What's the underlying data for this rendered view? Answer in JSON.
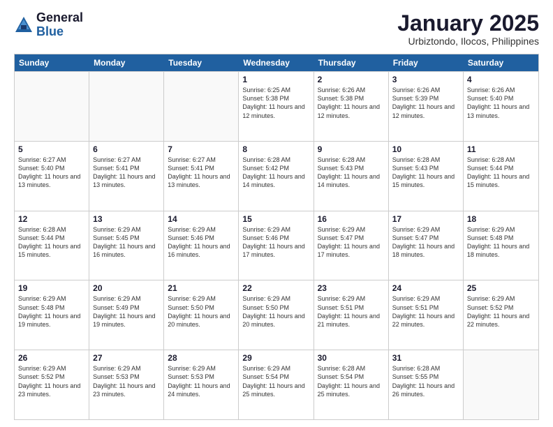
{
  "logo": {
    "general": "General",
    "blue": "Blue"
  },
  "header": {
    "month": "January 2025",
    "location": "Urbiztondo, Ilocos, Philippines"
  },
  "weekdays": [
    "Sunday",
    "Monday",
    "Tuesday",
    "Wednesday",
    "Thursday",
    "Friday",
    "Saturday"
  ],
  "weeks": [
    [
      {
        "day": "",
        "sunrise": "",
        "sunset": "",
        "daylight": "",
        "empty": true
      },
      {
        "day": "",
        "sunrise": "",
        "sunset": "",
        "daylight": "",
        "empty": true
      },
      {
        "day": "",
        "sunrise": "",
        "sunset": "",
        "daylight": "",
        "empty": true
      },
      {
        "day": "1",
        "sunrise": "Sunrise: 6:25 AM",
        "sunset": "Sunset: 5:38 PM",
        "daylight": "Daylight: 11 hours and 12 minutes.",
        "empty": false
      },
      {
        "day": "2",
        "sunrise": "Sunrise: 6:26 AM",
        "sunset": "Sunset: 5:38 PM",
        "daylight": "Daylight: 11 hours and 12 minutes.",
        "empty": false
      },
      {
        "day": "3",
        "sunrise": "Sunrise: 6:26 AM",
        "sunset": "Sunset: 5:39 PM",
        "daylight": "Daylight: 11 hours and 12 minutes.",
        "empty": false
      },
      {
        "day": "4",
        "sunrise": "Sunrise: 6:26 AM",
        "sunset": "Sunset: 5:40 PM",
        "daylight": "Daylight: 11 hours and 13 minutes.",
        "empty": false
      }
    ],
    [
      {
        "day": "5",
        "sunrise": "Sunrise: 6:27 AM",
        "sunset": "Sunset: 5:40 PM",
        "daylight": "Daylight: 11 hours and 13 minutes.",
        "empty": false
      },
      {
        "day": "6",
        "sunrise": "Sunrise: 6:27 AM",
        "sunset": "Sunset: 5:41 PM",
        "daylight": "Daylight: 11 hours and 13 minutes.",
        "empty": false
      },
      {
        "day": "7",
        "sunrise": "Sunrise: 6:27 AM",
        "sunset": "Sunset: 5:41 PM",
        "daylight": "Daylight: 11 hours and 13 minutes.",
        "empty": false
      },
      {
        "day": "8",
        "sunrise": "Sunrise: 6:28 AM",
        "sunset": "Sunset: 5:42 PM",
        "daylight": "Daylight: 11 hours and 14 minutes.",
        "empty": false
      },
      {
        "day": "9",
        "sunrise": "Sunrise: 6:28 AM",
        "sunset": "Sunset: 5:43 PM",
        "daylight": "Daylight: 11 hours and 14 minutes.",
        "empty": false
      },
      {
        "day": "10",
        "sunrise": "Sunrise: 6:28 AM",
        "sunset": "Sunset: 5:43 PM",
        "daylight": "Daylight: 11 hours and 15 minutes.",
        "empty": false
      },
      {
        "day": "11",
        "sunrise": "Sunrise: 6:28 AM",
        "sunset": "Sunset: 5:44 PM",
        "daylight": "Daylight: 11 hours and 15 minutes.",
        "empty": false
      }
    ],
    [
      {
        "day": "12",
        "sunrise": "Sunrise: 6:28 AM",
        "sunset": "Sunset: 5:44 PM",
        "daylight": "Daylight: 11 hours and 15 minutes.",
        "empty": false
      },
      {
        "day": "13",
        "sunrise": "Sunrise: 6:29 AM",
        "sunset": "Sunset: 5:45 PM",
        "daylight": "Daylight: 11 hours and 16 minutes.",
        "empty": false
      },
      {
        "day": "14",
        "sunrise": "Sunrise: 6:29 AM",
        "sunset": "Sunset: 5:46 PM",
        "daylight": "Daylight: 11 hours and 16 minutes.",
        "empty": false
      },
      {
        "day": "15",
        "sunrise": "Sunrise: 6:29 AM",
        "sunset": "Sunset: 5:46 PM",
        "daylight": "Daylight: 11 hours and 17 minutes.",
        "empty": false
      },
      {
        "day": "16",
        "sunrise": "Sunrise: 6:29 AM",
        "sunset": "Sunset: 5:47 PM",
        "daylight": "Daylight: 11 hours and 17 minutes.",
        "empty": false
      },
      {
        "day": "17",
        "sunrise": "Sunrise: 6:29 AM",
        "sunset": "Sunset: 5:47 PM",
        "daylight": "Daylight: 11 hours and 18 minutes.",
        "empty": false
      },
      {
        "day": "18",
        "sunrise": "Sunrise: 6:29 AM",
        "sunset": "Sunset: 5:48 PM",
        "daylight": "Daylight: 11 hours and 18 minutes.",
        "empty": false
      }
    ],
    [
      {
        "day": "19",
        "sunrise": "Sunrise: 6:29 AM",
        "sunset": "Sunset: 5:48 PM",
        "daylight": "Daylight: 11 hours and 19 minutes.",
        "empty": false
      },
      {
        "day": "20",
        "sunrise": "Sunrise: 6:29 AM",
        "sunset": "Sunset: 5:49 PM",
        "daylight": "Daylight: 11 hours and 19 minutes.",
        "empty": false
      },
      {
        "day": "21",
        "sunrise": "Sunrise: 6:29 AM",
        "sunset": "Sunset: 5:50 PM",
        "daylight": "Daylight: 11 hours and 20 minutes.",
        "empty": false
      },
      {
        "day": "22",
        "sunrise": "Sunrise: 6:29 AM",
        "sunset": "Sunset: 5:50 PM",
        "daylight": "Daylight: 11 hours and 20 minutes.",
        "empty": false
      },
      {
        "day": "23",
        "sunrise": "Sunrise: 6:29 AM",
        "sunset": "Sunset: 5:51 PM",
        "daylight": "Daylight: 11 hours and 21 minutes.",
        "empty": false
      },
      {
        "day": "24",
        "sunrise": "Sunrise: 6:29 AM",
        "sunset": "Sunset: 5:51 PM",
        "daylight": "Daylight: 11 hours and 22 minutes.",
        "empty": false
      },
      {
        "day": "25",
        "sunrise": "Sunrise: 6:29 AM",
        "sunset": "Sunset: 5:52 PM",
        "daylight": "Daylight: 11 hours and 22 minutes.",
        "empty": false
      }
    ],
    [
      {
        "day": "26",
        "sunrise": "Sunrise: 6:29 AM",
        "sunset": "Sunset: 5:52 PM",
        "daylight": "Daylight: 11 hours and 23 minutes.",
        "empty": false
      },
      {
        "day": "27",
        "sunrise": "Sunrise: 6:29 AM",
        "sunset": "Sunset: 5:53 PM",
        "daylight": "Daylight: 11 hours and 23 minutes.",
        "empty": false
      },
      {
        "day": "28",
        "sunrise": "Sunrise: 6:29 AM",
        "sunset": "Sunset: 5:53 PM",
        "daylight": "Daylight: 11 hours and 24 minutes.",
        "empty": false
      },
      {
        "day": "29",
        "sunrise": "Sunrise: 6:29 AM",
        "sunset": "Sunset: 5:54 PM",
        "daylight": "Daylight: 11 hours and 25 minutes.",
        "empty": false
      },
      {
        "day": "30",
        "sunrise": "Sunrise: 6:28 AM",
        "sunset": "Sunset: 5:54 PM",
        "daylight": "Daylight: 11 hours and 25 minutes.",
        "empty": false
      },
      {
        "day": "31",
        "sunrise": "Sunrise: 6:28 AM",
        "sunset": "Sunset: 5:55 PM",
        "daylight": "Daylight: 11 hours and 26 minutes.",
        "empty": false
      },
      {
        "day": "",
        "sunrise": "",
        "sunset": "",
        "daylight": "",
        "empty": true
      }
    ]
  ]
}
